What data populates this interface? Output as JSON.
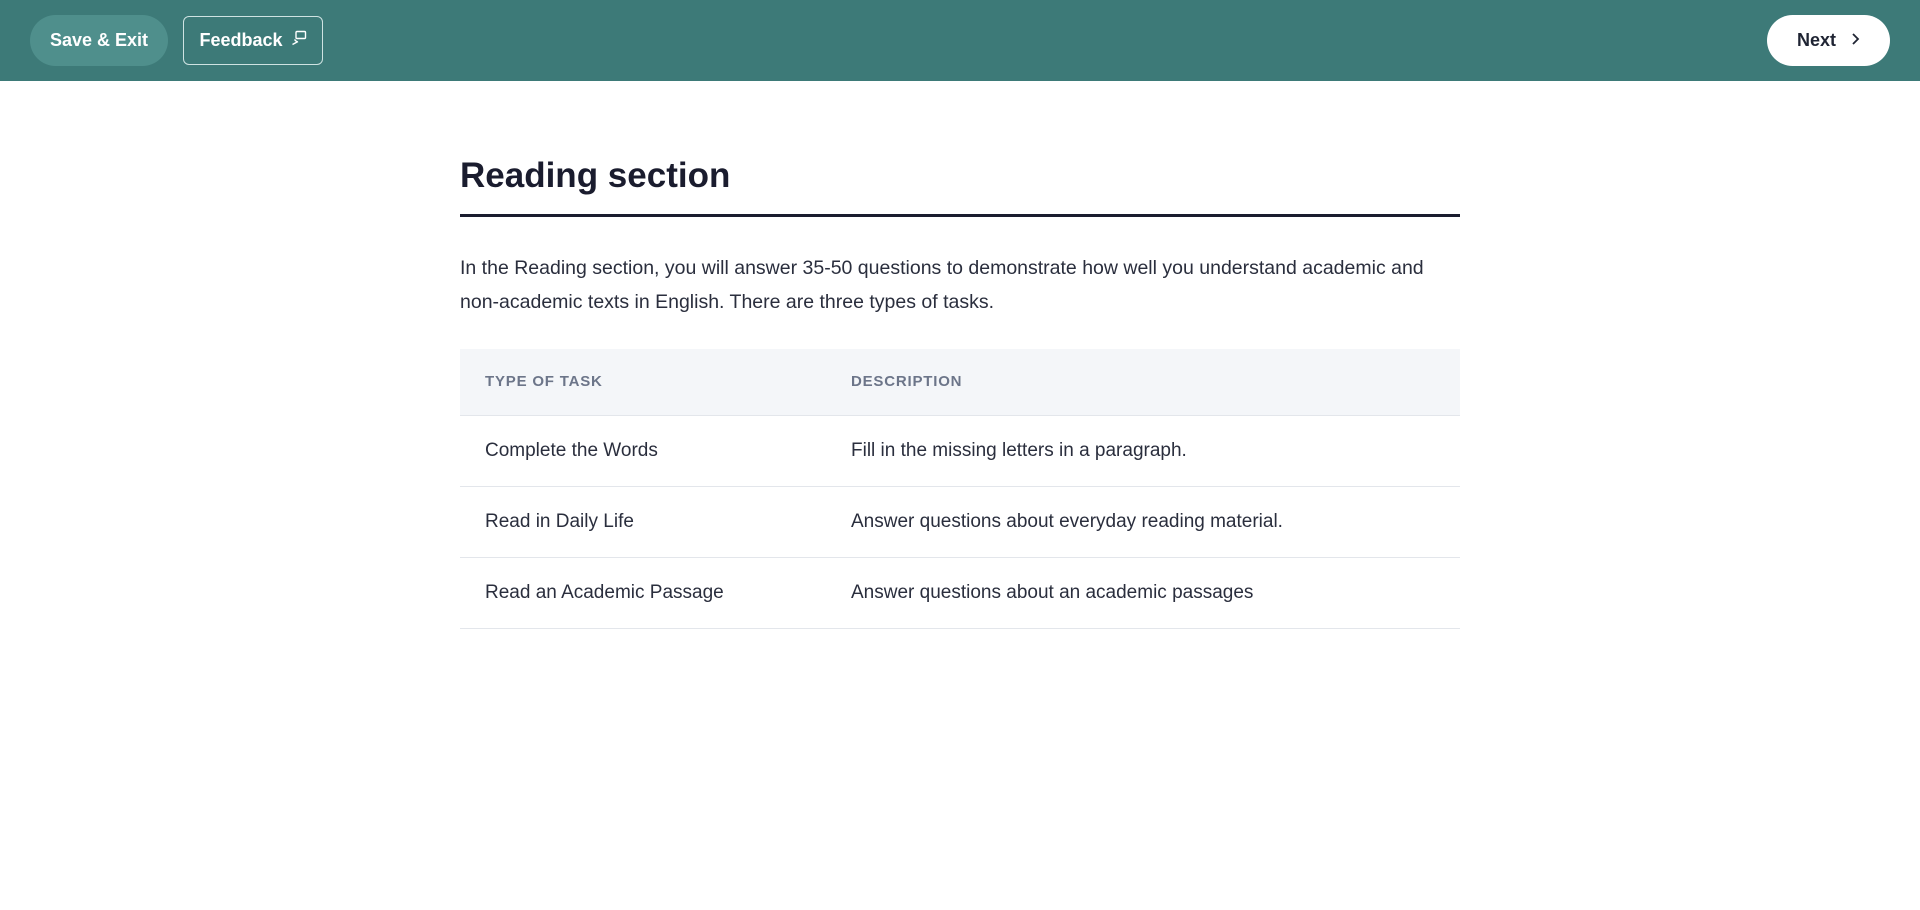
{
  "topbar": {
    "save_exit_label": "Save & Exit",
    "feedback_label": "Feedback",
    "next_label": "Next",
    "bg_color": "#3d7a78"
  },
  "main": {
    "title": "Reading section",
    "intro": "In the Reading section, you will answer 35-50 questions to demonstrate how well you understand academic and non-academic texts in English. There are three types of tasks.",
    "table": {
      "headers": [
        "TYPE OF TASK",
        "DESCRIPTION"
      ],
      "rows": [
        [
          "Complete the Words",
          "Fill in the missing letters in a paragraph."
        ],
        [
          "Read in Daily Life",
          "Answer questions about everyday reading material."
        ],
        [
          "Read an Academic Passage",
          "Answer questions about an academic passages"
        ]
      ]
    }
  }
}
